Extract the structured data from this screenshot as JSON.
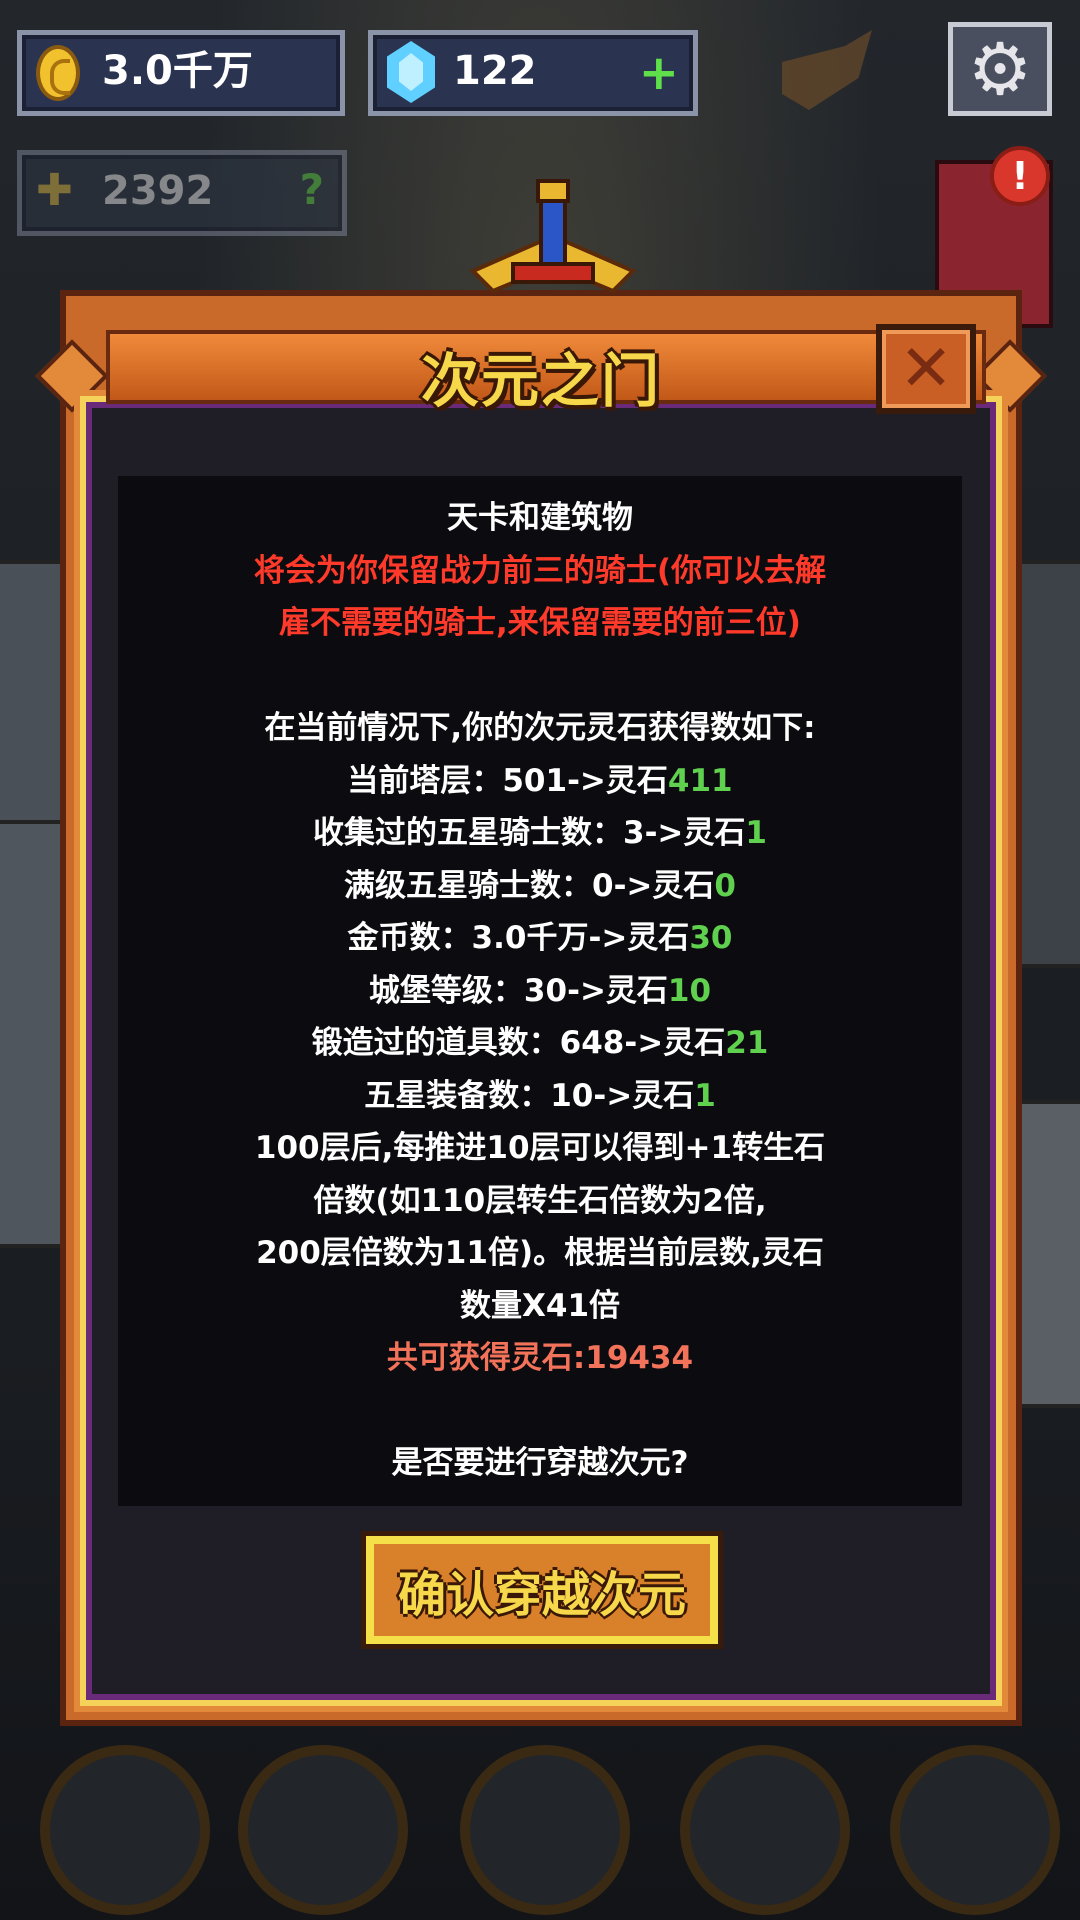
{
  "hud": {
    "gold": "3.0千万",
    "gems": "122",
    "power": "2392",
    "power_hint": "?",
    "alert": "!"
  },
  "icons": {
    "gold": "coin-icon",
    "gems": "diamond-icon",
    "gems_add": "plus-icon",
    "power": "sword-icon",
    "settings": "gear-icon",
    "close": "close-icon"
  },
  "dialog": {
    "title": "次元之门",
    "close_glyph": "✕",
    "lines": [
      {
        "segments": [
          {
            "text": "天卡和建筑物",
            "color": "white"
          }
        ]
      },
      {
        "segments": [
          {
            "text": "将会为你保留战力前三的骑士(你可以去解",
            "color": "red"
          }
        ]
      },
      {
        "segments": [
          {
            "text": "雇不需要的骑士,来保留需要的前三位)",
            "color": "red"
          }
        ]
      },
      {
        "segments": []
      },
      {
        "segments": [
          {
            "text": "在当前情况下,你的次元灵石获得数如下:",
            "color": "white"
          }
        ]
      },
      {
        "segments": [
          {
            "text": "当前塔层：501->灵石",
            "color": "white"
          },
          {
            "text": "411",
            "color": "green"
          }
        ]
      },
      {
        "segments": [
          {
            "text": "收集过的五星骑士数：3->灵石",
            "color": "white"
          },
          {
            "text": "1",
            "color": "green"
          }
        ]
      },
      {
        "segments": [
          {
            "text": "满级五星骑士数：0->灵石",
            "color": "white"
          },
          {
            "text": "0",
            "color": "green"
          }
        ]
      },
      {
        "segments": [
          {
            "text": "金币数：3.0千万->灵石",
            "color": "white"
          },
          {
            "text": "30",
            "color": "green"
          }
        ]
      },
      {
        "segments": [
          {
            "text": "城堡等级：30->灵石",
            "color": "white"
          },
          {
            "text": "10",
            "color": "green"
          }
        ]
      },
      {
        "segments": [
          {
            "text": "锻造过的道具数：648->灵石",
            "color": "white"
          },
          {
            "text": "21",
            "color": "green"
          }
        ]
      },
      {
        "segments": [
          {
            "text": "五星装备数：10->灵石",
            "color": "white"
          },
          {
            "text": "1",
            "color": "green"
          }
        ]
      },
      {
        "segments": [
          {
            "text": "100层后,每推进10层可以得到+1转生石",
            "color": "white"
          }
        ]
      },
      {
        "segments": [
          {
            "text": "倍数(如110层转生石倍数为2倍,",
            "color": "white"
          }
        ]
      },
      {
        "segments": [
          {
            "text": "200层倍数为11倍)。根据当前层数,灵石",
            "color": "white"
          }
        ]
      },
      {
        "segments": [
          {
            "text": "数量X41倍",
            "color": "white"
          }
        ]
      },
      {
        "segments": [
          {
            "text": "共可获得灵石:19434",
            "color": "salmon"
          }
        ]
      },
      {
        "segments": []
      },
      {
        "segments": [
          {
            "text": "是否要进行穿越次元?",
            "color": "white"
          }
        ]
      }
    ],
    "confirm_label": "确认穿越次元"
  },
  "colors": {
    "white": "#ffffff",
    "red": "#ff3a2a",
    "green": "#5fd14f",
    "salmon": "#f2725a",
    "title_gold": "#f6d84a",
    "frame_orange": "#c96a2a"
  }
}
